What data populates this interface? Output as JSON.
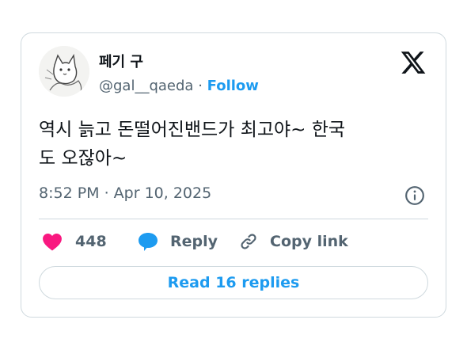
{
  "tweet": {
    "author_name": "페기 구",
    "handle": "@gal__qaeda",
    "separator": "·",
    "follow_label": "Follow",
    "text_line1": "역시 늙고 돈떨어진밴드가 최고야~ 한국",
    "text_line2": "도 오잖아~",
    "timestamp": "8:52 PM · Apr 10, 2025",
    "like_count": "448",
    "reply_label": "Reply",
    "copy_link_label": "Copy link",
    "read_replies_label": "Read 16 replies"
  },
  "icons": {
    "brand": "x-logo-icon",
    "info": "info-icon",
    "like": "heart-icon",
    "reply": "speech-bubble-icon",
    "copy": "link-icon"
  },
  "colors": {
    "accent": "#1d9bf0",
    "like": "#f91880",
    "text": "#0f1419",
    "muted": "#536471",
    "border": "#cfd9de"
  }
}
